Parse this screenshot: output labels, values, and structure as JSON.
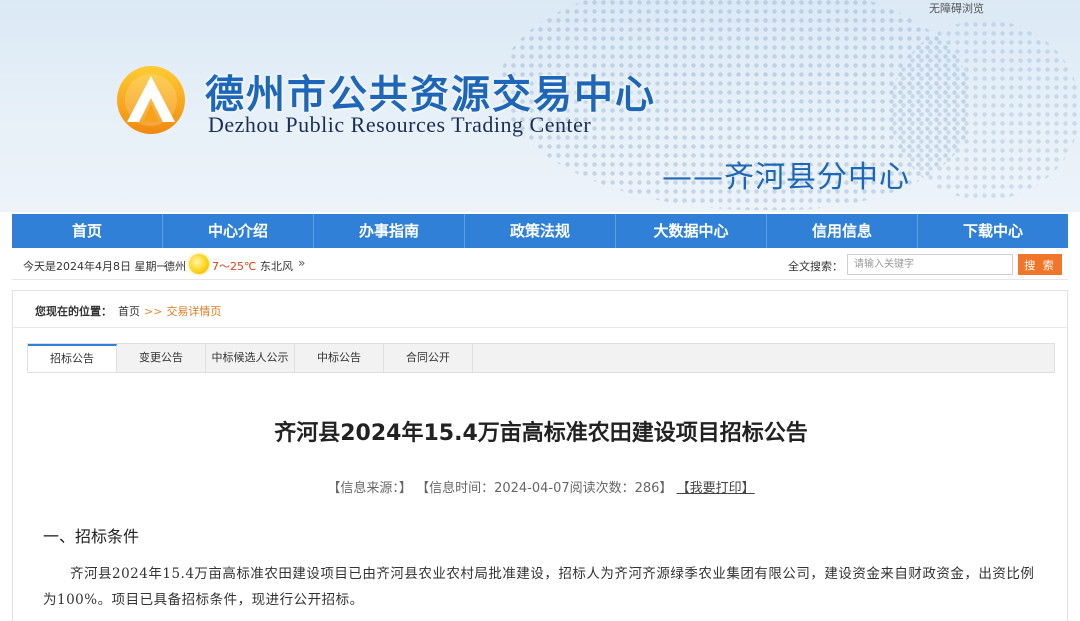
{
  "header": {
    "accessible_link": "无障碍浏览",
    "title_cn": "德州市公共资源交易中心",
    "title_en": "Dezhou Public Resources Trading Center",
    "branch": "——齐河县分中心"
  },
  "nav": {
    "items": [
      {
        "label": "首页"
      },
      {
        "label": "中心介绍"
      },
      {
        "label": "办事指南"
      },
      {
        "label": "政策法规"
      },
      {
        "label": "大数据中心"
      },
      {
        "label": "信用信息"
      },
      {
        "label": "下载中心"
      }
    ]
  },
  "infobar": {
    "today": "今天是2024年4月8日 星期一",
    "city": "德州",
    "temperature": "7～25℃",
    "wind": "东北风",
    "wind_more": "»",
    "search_label": "全文搜索：",
    "search_placeholder": "请输入关键字",
    "search_button": "搜 索"
  },
  "breadcrumb": {
    "label": "您现在的位置：",
    "home": "首页",
    "separator": ">>",
    "current": "交易详情页"
  },
  "tabs": [
    {
      "label": "招标公告",
      "active": true
    },
    {
      "label": "变更公告",
      "active": false
    },
    {
      "label": "中标候选人公示",
      "active": false
    },
    {
      "label": "中标公告",
      "active": false
    },
    {
      "label": "合同公开",
      "active": false
    }
  ],
  "article": {
    "title": "齐河县2024年15.4万亩高标准农田建设项目招标公告",
    "meta_source": "【信息来源：】",
    "meta_time": "【信息时间：2024-04-07阅读次数：286】",
    "meta_print": "【我要打印】",
    "section1_heading": "一、招标条件",
    "section1_body": "齐河县2024年15.4万亩高标准农田建设项目已由齐河县农业农村局批准建设，招标人为齐河齐源绿季农业集团有限公司，建设资金来自财政资金，出资比例为100%。项目已具备招标条件，现进行公开招标。"
  },
  "colors": {
    "nav_bg": "#2f80d6",
    "brand_blue": "#1d66b8",
    "search_button": "#f0762a",
    "breadcrumb_current": "#e07a20"
  }
}
